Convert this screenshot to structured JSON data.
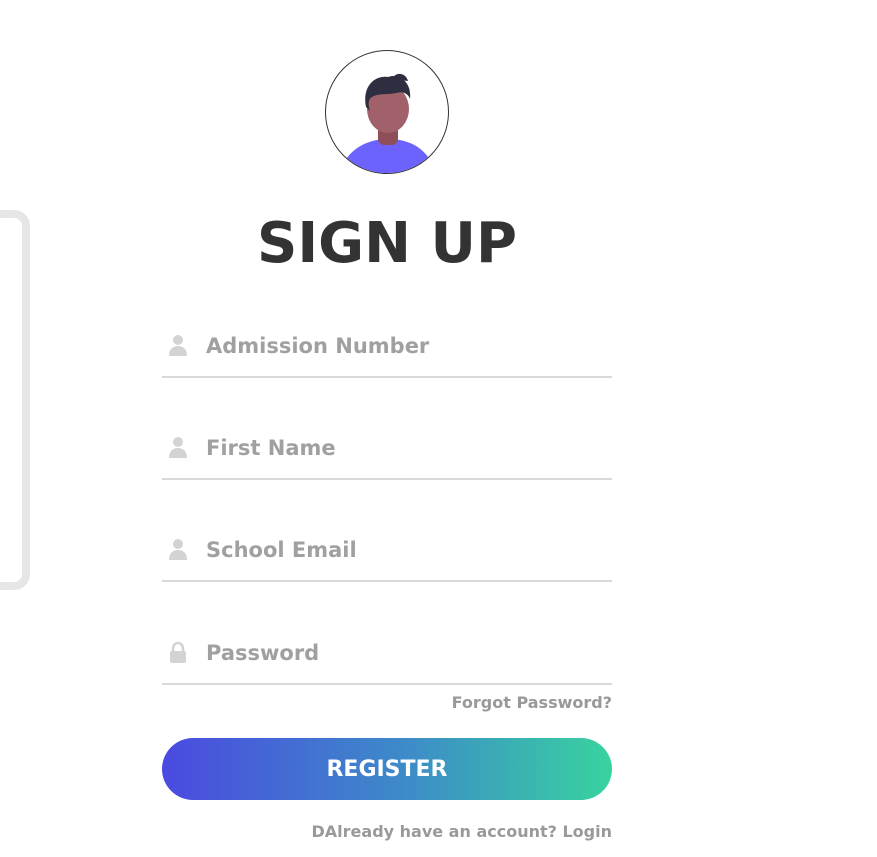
{
  "heading": "SIGN UP",
  "fields": {
    "admission_number": {
      "placeholder": "Admission Number",
      "value": "",
      "icon": "user-icon"
    },
    "first_name": {
      "placeholder": "First Name",
      "value": "",
      "icon": "user-icon"
    },
    "school_email": {
      "placeholder": "School Email",
      "value": "",
      "icon": "user-icon"
    },
    "password": {
      "placeholder": "Password",
      "value": "",
      "icon": "lock-icon"
    }
  },
  "forgot_password_link": "Forgot Password?",
  "register_button": "REGISTER",
  "footer": {
    "text": "DAlready have an account? ",
    "login_link": "Login"
  },
  "colors": {
    "heading": "#333333",
    "placeholder": "#a0a0a0",
    "button_gradient_start": "#4a4ae0",
    "button_gradient_end": "#38d39f",
    "link": "#999999",
    "avatar_shirt": "#6c63ff",
    "avatar_skin": "#a0616a",
    "avatar_hair": "#2f2e41"
  }
}
